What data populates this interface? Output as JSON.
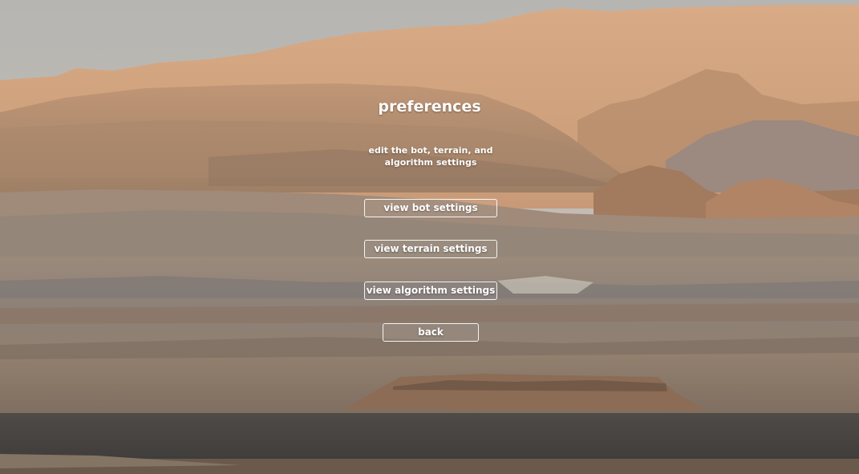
{
  "menu": {
    "title": "preferences",
    "subtitle": "edit the bot, terrain, and algorithm settings",
    "buttons": {
      "bot": "view bot settings",
      "terrain": "view terrain settings",
      "algorithm": "view algorithm settings",
      "back": "back"
    }
  },
  "colors": {
    "sky": "#b9b8b4",
    "far_mountain": "#cfa07c",
    "mid_hill": "#b98d6c",
    "plain": "#8b7d70",
    "dark_sand": "#4a4845",
    "text": "#ffffff"
  }
}
